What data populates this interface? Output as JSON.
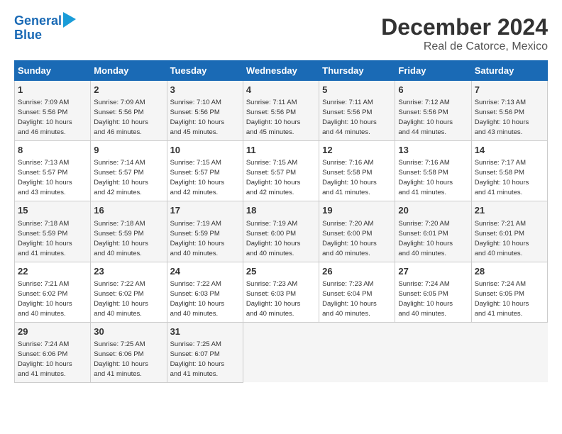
{
  "logo": {
    "line1": "General",
    "line2": "Blue"
  },
  "title": "December 2024",
  "location": "Real de Catorce, Mexico",
  "days_of_week": [
    "Sunday",
    "Monday",
    "Tuesday",
    "Wednesday",
    "Thursday",
    "Friday",
    "Saturday"
  ],
  "weeks": [
    [
      {
        "day": "1",
        "sunrise": "7:09 AM",
        "sunset": "5:56 PM",
        "daylight": "10 hours and 46 minutes."
      },
      {
        "day": "2",
        "sunrise": "7:09 AM",
        "sunset": "5:56 PM",
        "daylight": "10 hours and 46 minutes."
      },
      {
        "day": "3",
        "sunrise": "7:10 AM",
        "sunset": "5:56 PM",
        "daylight": "10 hours and 45 minutes."
      },
      {
        "day": "4",
        "sunrise": "7:11 AM",
        "sunset": "5:56 PM",
        "daylight": "10 hours and 45 minutes."
      },
      {
        "day": "5",
        "sunrise": "7:11 AM",
        "sunset": "5:56 PM",
        "daylight": "10 hours and 44 minutes."
      },
      {
        "day": "6",
        "sunrise": "7:12 AM",
        "sunset": "5:56 PM",
        "daylight": "10 hours and 44 minutes."
      },
      {
        "day": "7",
        "sunrise": "7:13 AM",
        "sunset": "5:56 PM",
        "daylight": "10 hours and 43 minutes."
      }
    ],
    [
      {
        "day": "8",
        "sunrise": "7:13 AM",
        "sunset": "5:57 PM",
        "daylight": "10 hours and 43 minutes."
      },
      {
        "day": "9",
        "sunrise": "7:14 AM",
        "sunset": "5:57 PM",
        "daylight": "10 hours and 42 minutes."
      },
      {
        "day": "10",
        "sunrise": "7:15 AM",
        "sunset": "5:57 PM",
        "daylight": "10 hours and 42 minutes."
      },
      {
        "day": "11",
        "sunrise": "7:15 AM",
        "sunset": "5:57 PM",
        "daylight": "10 hours and 42 minutes."
      },
      {
        "day": "12",
        "sunrise": "7:16 AM",
        "sunset": "5:58 PM",
        "daylight": "10 hours and 41 minutes."
      },
      {
        "day": "13",
        "sunrise": "7:16 AM",
        "sunset": "5:58 PM",
        "daylight": "10 hours and 41 minutes."
      },
      {
        "day": "14",
        "sunrise": "7:17 AM",
        "sunset": "5:58 PM",
        "daylight": "10 hours and 41 minutes."
      }
    ],
    [
      {
        "day": "15",
        "sunrise": "7:18 AM",
        "sunset": "5:59 PM",
        "daylight": "10 hours and 41 minutes."
      },
      {
        "day": "16",
        "sunrise": "7:18 AM",
        "sunset": "5:59 PM",
        "daylight": "10 hours and 40 minutes."
      },
      {
        "day": "17",
        "sunrise": "7:19 AM",
        "sunset": "5:59 PM",
        "daylight": "10 hours and 40 minutes."
      },
      {
        "day": "18",
        "sunrise": "7:19 AM",
        "sunset": "6:00 PM",
        "daylight": "10 hours and 40 minutes."
      },
      {
        "day": "19",
        "sunrise": "7:20 AM",
        "sunset": "6:00 PM",
        "daylight": "10 hours and 40 minutes."
      },
      {
        "day": "20",
        "sunrise": "7:20 AM",
        "sunset": "6:01 PM",
        "daylight": "10 hours and 40 minutes."
      },
      {
        "day": "21",
        "sunrise": "7:21 AM",
        "sunset": "6:01 PM",
        "daylight": "10 hours and 40 minutes."
      }
    ],
    [
      {
        "day": "22",
        "sunrise": "7:21 AM",
        "sunset": "6:02 PM",
        "daylight": "10 hours and 40 minutes."
      },
      {
        "day": "23",
        "sunrise": "7:22 AM",
        "sunset": "6:02 PM",
        "daylight": "10 hours and 40 minutes."
      },
      {
        "day": "24",
        "sunrise": "7:22 AM",
        "sunset": "6:03 PM",
        "daylight": "10 hours and 40 minutes."
      },
      {
        "day": "25",
        "sunrise": "7:23 AM",
        "sunset": "6:03 PM",
        "daylight": "10 hours and 40 minutes."
      },
      {
        "day": "26",
        "sunrise": "7:23 AM",
        "sunset": "6:04 PM",
        "daylight": "10 hours and 40 minutes."
      },
      {
        "day": "27",
        "sunrise": "7:24 AM",
        "sunset": "6:05 PM",
        "daylight": "10 hours and 40 minutes."
      },
      {
        "day": "28",
        "sunrise": "7:24 AM",
        "sunset": "6:05 PM",
        "daylight": "10 hours and 41 minutes."
      }
    ],
    [
      {
        "day": "29",
        "sunrise": "7:24 AM",
        "sunset": "6:06 PM",
        "daylight": "10 hours and 41 minutes."
      },
      {
        "day": "30",
        "sunrise": "7:25 AM",
        "sunset": "6:06 PM",
        "daylight": "10 hours and 41 minutes."
      },
      {
        "day": "31",
        "sunrise": "7:25 AM",
        "sunset": "6:07 PM",
        "daylight": "10 hours and 41 minutes."
      },
      null,
      null,
      null,
      null
    ]
  ],
  "labels": {
    "sunrise": "Sunrise:",
    "sunset": "Sunset:",
    "daylight": "Daylight:"
  }
}
